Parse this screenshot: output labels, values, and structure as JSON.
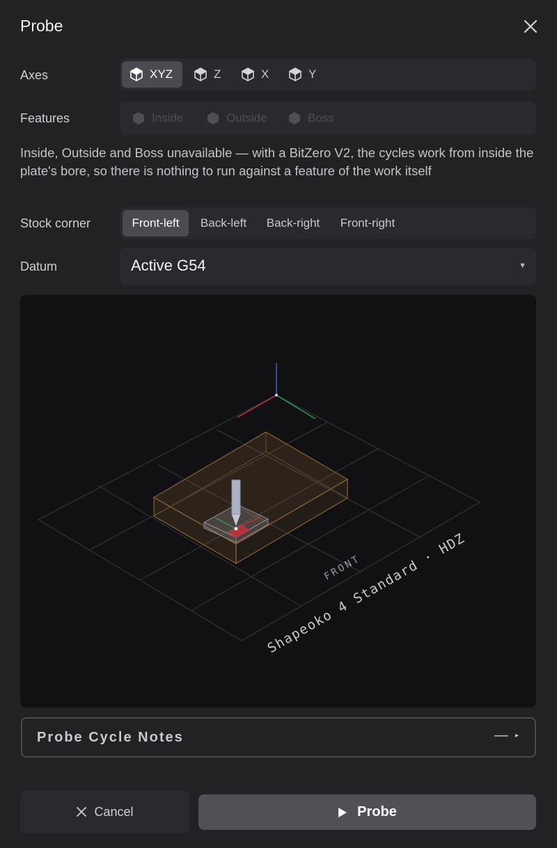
{
  "dialog": {
    "title": "Probe",
    "close_icon": "close-icon"
  },
  "axes": {
    "label": "Axes",
    "options": [
      {
        "label": "XYZ",
        "icon": "cube-icon",
        "active": true
      },
      {
        "label": "Z",
        "icon": "cube-icon",
        "active": false
      },
      {
        "label": "X",
        "icon": "cube-icon",
        "active": false
      },
      {
        "label": "Y",
        "icon": "cube-icon",
        "active": false
      }
    ]
  },
  "features": {
    "label": "Features",
    "options": [
      {
        "label": "Inside",
        "icon": "cube-icon",
        "disabled": true
      },
      {
        "label": "Outside",
        "icon": "cube-icon",
        "disabled": true
      },
      {
        "label": "Boss",
        "icon": "cube-icon",
        "disabled": true
      }
    ],
    "note": "Inside, Outside and Boss unavailable — with a BitZero V2, the cycles work from inside the plate's bore, so there is nothing to run against a feature of the work itself"
  },
  "stock_corner": {
    "label": "Stock corner",
    "options": [
      {
        "label": "Front-left",
        "active": true
      },
      {
        "label": "Back-left",
        "active": false
      },
      {
        "label": "Back-right",
        "active": false
      },
      {
        "label": "Front-right",
        "active": false
      }
    ]
  },
  "datum": {
    "label": "Datum",
    "value": "Active G54"
  },
  "viewport": {
    "front_label": "FRONT",
    "machine_label": "Shapeoko 4 Standard · HDZ"
  },
  "notes_panel": {
    "label": "Probe Cycle Notes",
    "dash": "—",
    "expand_glyph": "▸"
  },
  "actions": {
    "cancel_label": "Cancel",
    "probe_label": "Probe"
  },
  "colors": {
    "accent_active": "#4a4a50",
    "axis_x": "#d6333a",
    "axis_y": "#3fae5a",
    "axis_z": "#3a63c9",
    "stock": "#b07a3c"
  }
}
